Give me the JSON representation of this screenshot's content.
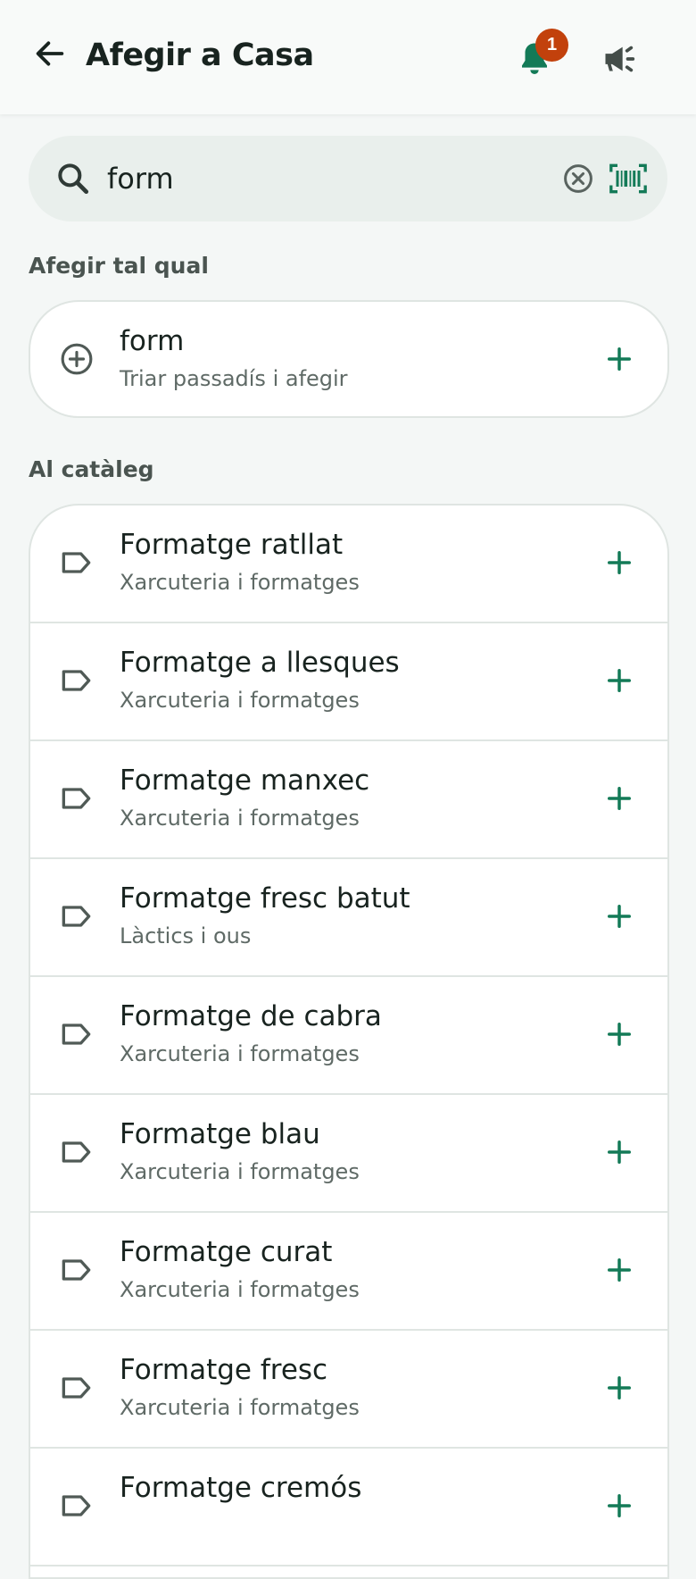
{
  "header": {
    "title": "Afegir a Casa",
    "notification_count": "1"
  },
  "search": {
    "value": "form",
    "placeholder": ""
  },
  "sections": {
    "as_is": "Afegir tal qual",
    "catalog": "Al catàleg"
  },
  "as_is_item": {
    "title": "form",
    "subtitle": "Triar passadís i afegir"
  },
  "catalog_items": [
    {
      "title": "Formatge ratllat",
      "subtitle": "Xarcuteria i formatges"
    },
    {
      "title": "Formatge a llesques",
      "subtitle": "Xarcuteria i formatges"
    },
    {
      "title": "Formatge manxec",
      "subtitle": "Xarcuteria i formatges"
    },
    {
      "title": "Formatge fresc batut",
      "subtitle": "Làctics i ous"
    },
    {
      "title": "Formatge de cabra",
      "subtitle": "Xarcuteria i formatges"
    },
    {
      "title": "Formatge blau",
      "subtitle": "Xarcuteria i formatges"
    },
    {
      "title": "Formatge curat",
      "subtitle": "Xarcuteria i formatges"
    },
    {
      "title": "Formatge fresc",
      "subtitle": "Xarcuteria i formatges"
    },
    {
      "title": "Formatge cremós",
      "subtitle": ""
    }
  ],
  "colors": {
    "accent": "#137a57",
    "badge": "#c2410c",
    "text_primary": "#18231f",
    "text_secondary": "#5f6a66",
    "icon_muted": "#505a56",
    "search_bg": "#e9efec",
    "page_bg": "#f4f7f6"
  },
  "icons": {
    "back": "arrow-left-icon",
    "notifications": "bell-icon",
    "announcements": "megaphone-icon",
    "search": "search-icon",
    "clear": "clear-circle-x-icon",
    "barcode": "barcode-scan-icon",
    "add_as_is": "plus-circle-icon",
    "catalog_item": "tag-label-icon",
    "add": "plus-icon"
  }
}
